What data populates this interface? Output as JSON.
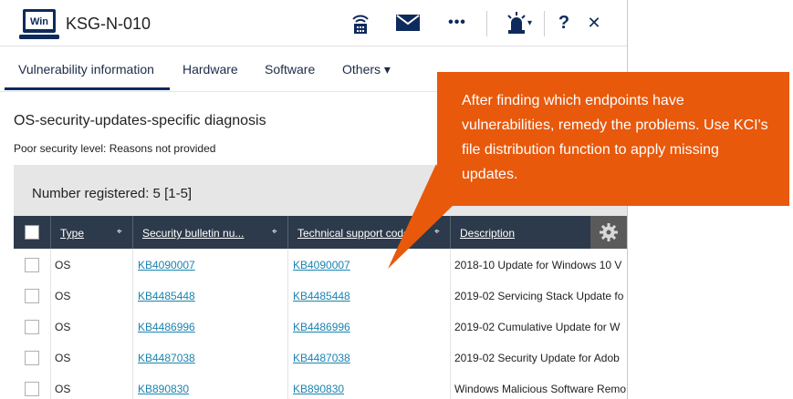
{
  "header": {
    "logo_text": "Win",
    "title": "KSG-N-010",
    "icons": [
      "network-icon",
      "mail-icon",
      "more-icon",
      "alert-beacon-icon",
      "help-icon",
      "close-icon"
    ],
    "help_label": "?",
    "close_label": "✕",
    "more_label": "•••",
    "dropdown_caret": "▾"
  },
  "tabs": [
    {
      "label": "Vulnerability information",
      "active": true
    },
    {
      "label": "Hardware"
    },
    {
      "label": "Software"
    },
    {
      "label": "Others ▾"
    }
  ],
  "section": {
    "title": "OS-security-updates-specific diagnosis",
    "subtitle": "Poor security level: Reasons not provided",
    "count_label": "Number registered: 5  [1-5]"
  },
  "table": {
    "columns": [
      "Type",
      "Security bulletin nu...",
      "Technical support code",
      "Description"
    ],
    "rows": [
      {
        "type": "OS",
        "bulletin": "KB4090007",
        "support": "KB4090007",
        "description": "2018-10 Update for Windows 10 V"
      },
      {
        "type": "OS",
        "bulletin": "KB4485448",
        "support": "KB4485448",
        "description": "2019-02 Servicing Stack Update fo"
      },
      {
        "type": "OS",
        "bulletin": "KB4486996",
        "support": "KB4486996",
        "description": "2019-02 Cumulative Update for W"
      },
      {
        "type": "OS",
        "bulletin": "KB4487038",
        "support": "KB4487038",
        "description": "2019-02 Security Update for Adob"
      },
      {
        "type": "OS",
        "bulletin": "KB890830",
        "support": "KB890830",
        "description": "Windows Malicious Software Remo"
      }
    ]
  },
  "callout": {
    "text": "After finding which endpoints have vulnerabilities, remedy the problems. Use KCI's file distribution function to apply missing updates."
  },
  "colors": {
    "header_dark": "#2d3a4b",
    "accent_navy": "#0e2a5c",
    "link": "#1a84b0",
    "callout": "#e8590c"
  }
}
